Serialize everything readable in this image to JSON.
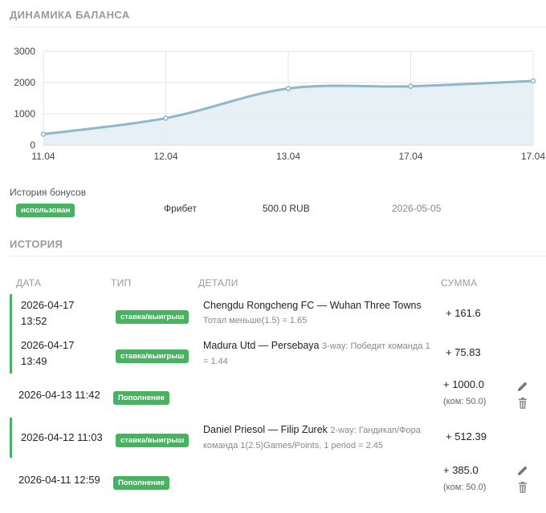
{
  "balance": {
    "title": "ДИНАМИКА БАЛАНСА"
  },
  "chart_data": {
    "type": "area",
    "title": "",
    "xlabel": "",
    "ylabel": "",
    "categories": [
      "11.04",
      "12.04",
      "13.04",
      "17.04",
      "17.04"
    ],
    "values": [
      350,
      860,
      1810,
      1880,
      2050
    ],
    "ylim": [
      0,
      3000
    ],
    "yticks": [
      0,
      1000,
      2000,
      3000
    ],
    "grid": true,
    "legend": "none",
    "line_color": "#8fb6c9",
    "fill_color": "#e3edf2"
  },
  "bonuses": {
    "title": "История бонусов",
    "items": [
      {
        "status": "использован",
        "type": "Фрибет",
        "amount": "500.0 RUB",
        "date": "2026-05-05"
      }
    ]
  },
  "history": {
    "title": "ИСТОРИЯ",
    "columns": {
      "date": "ДАТА",
      "type": "ТИП",
      "details": "ДЕТАЛИ",
      "sum": "СУММА"
    },
    "rows": [
      {
        "date": "2026-04-17\n13:52",
        "type": "ставка/выигрыш",
        "title": "Chengdu Rongcheng FC — Wuhan Three Towns",
        "sub": "Тотал меньше(1.5) = 1.65",
        "amount": "+ 161.6",
        "fee": ""
      },
      {
        "date": "2026-04-17\n13:49",
        "type": "ставка/выигрыш",
        "title": "Madura Utd — Persebaya",
        "sub": "3-way: Победит команда 1 = 1.44",
        "amount": "+ 75.83",
        "fee": ""
      },
      {
        "date": "2026-04-13 11:42",
        "type": "Пополнение",
        "title": "",
        "sub": "",
        "amount": "+ 1000.0",
        "fee": "(ком: 50.0)"
      },
      {
        "date": "2026-04-12 11:03",
        "type": "ставка/выигрыш",
        "title": "Daniel Priesol — Filip Zurek",
        "sub": "2-way: Гандикап/Фора команда 1(2.5)Games/Points, 1 period = 2.45",
        "amount": "+ 512.39",
        "fee": ""
      },
      {
        "date": "2026-04-11 12:59",
        "type": "Пополнение",
        "title": "",
        "sub": "",
        "amount": "+ 385.0",
        "fee": "(ком: 50.0)"
      }
    ]
  },
  "icons": {
    "edit": "pencil-icon",
    "delete": "trash-icon"
  },
  "colors": {
    "badge": "#47b260",
    "win_border": "#47b260",
    "muted_text": "#9a9a9a"
  }
}
